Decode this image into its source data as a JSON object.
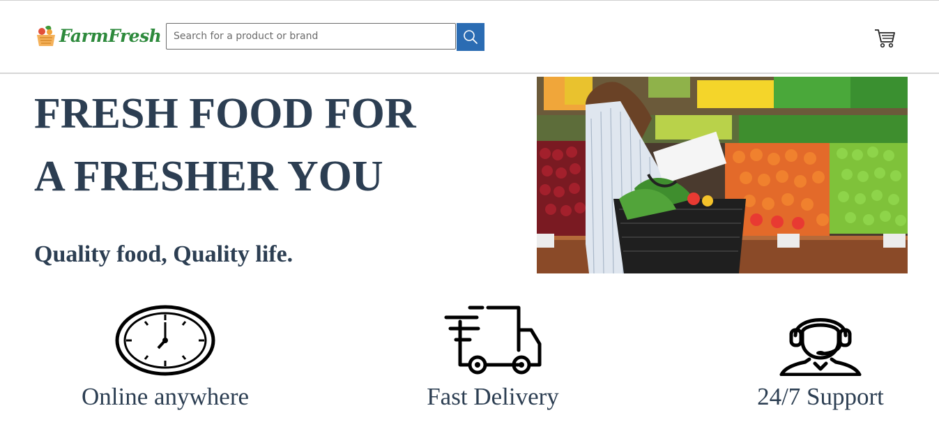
{
  "header": {
    "logo_text": "FarmFresh",
    "search": {
      "placeholder": "Search for a product or brand",
      "value": ""
    }
  },
  "hero": {
    "title_line1": "FRESH FOOD FOR",
    "title_line2": "A FRESHER YOU",
    "tagline": "Quality food, Quality life."
  },
  "features": [
    {
      "label": "Online anywhere",
      "icon": "clock-icon"
    },
    {
      "label": "Fast Delivery",
      "icon": "delivery-truck-icon"
    },
    {
      "label": "24/7 Support",
      "icon": "support-agent-icon"
    }
  ],
  "colors": {
    "heading": "#2c3e52",
    "brand_green": "#2d8a3c",
    "search_button": "#2b6cb3"
  }
}
